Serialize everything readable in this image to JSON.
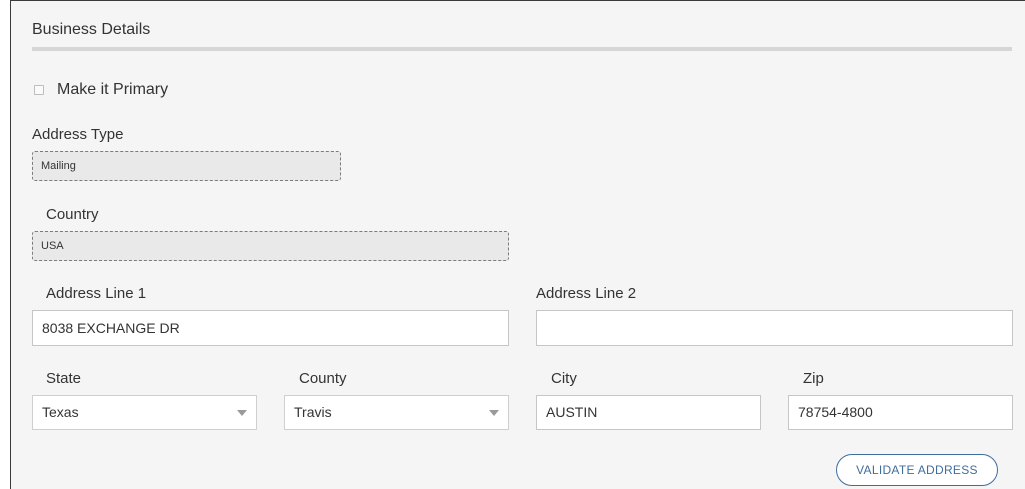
{
  "section": {
    "title": "Business Details"
  },
  "primary": {
    "label": "Make it Primary",
    "checked": false
  },
  "address_type": {
    "label": "Address Type",
    "value": "Mailing"
  },
  "country": {
    "label": "Country",
    "value": "USA"
  },
  "address_line1": {
    "label": "Address Line 1",
    "value": "8038 EXCHANGE DR"
  },
  "address_line2": {
    "label": "Address Line 2",
    "value": ""
  },
  "state": {
    "label": "State",
    "value": "Texas"
  },
  "county": {
    "label": "County",
    "value": "Travis"
  },
  "city": {
    "label": "City",
    "value": "AUSTIN"
  },
  "zip": {
    "label": "Zip",
    "value": "78754-4800"
  },
  "actions": {
    "validate_label": "VALIDATE ADDRESS"
  },
  "colors": {
    "accent": "#3f6d9c",
    "panel_bg": "#f5f5f5",
    "readonly_bg": "#e9e9e9"
  },
  "icons": {
    "dropdown": "chevron-down-icon"
  }
}
